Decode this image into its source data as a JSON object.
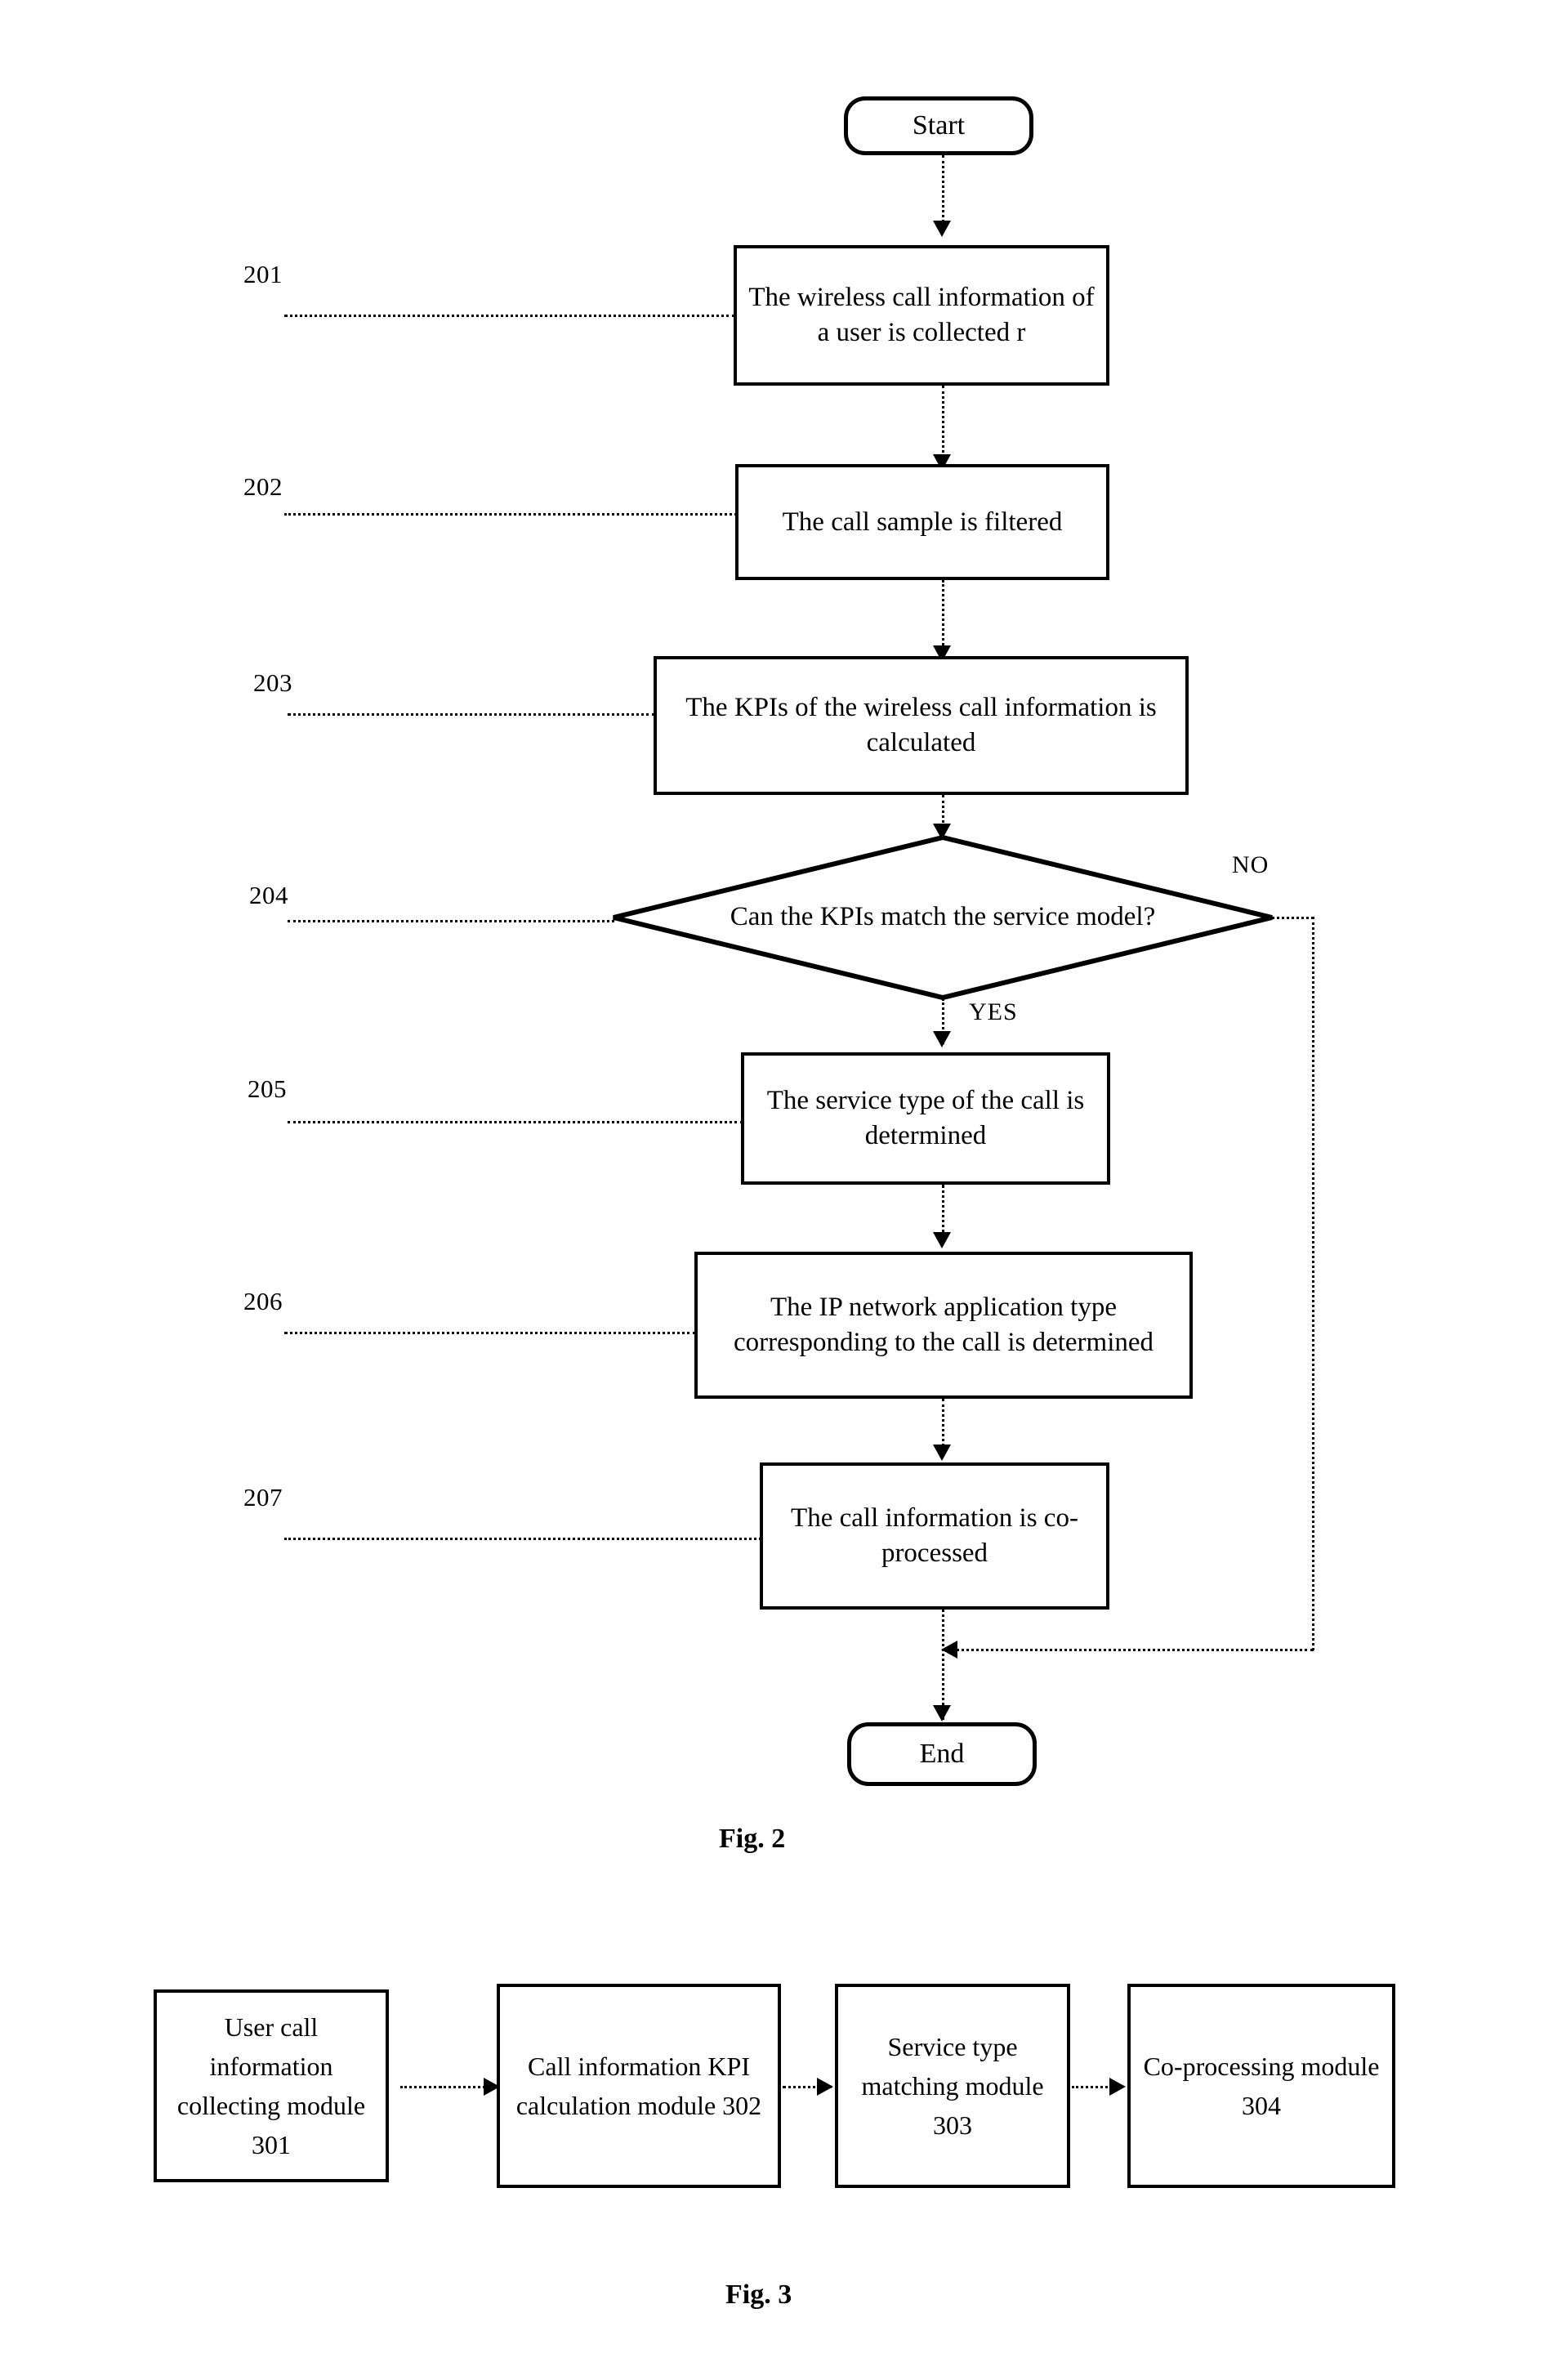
{
  "figure2": {
    "caption": "Fig. 2",
    "start": {
      "label": "Start"
    },
    "end": {
      "label": "End"
    },
    "branches": {
      "yes": "YES",
      "no": "NO"
    },
    "steps": [
      {
        "num": "201",
        "text": "The wireless call information of a user is collected r"
      },
      {
        "num": "202",
        "text": "The call sample is filtered"
      },
      {
        "num": "203",
        "text": "The KPIs of the wireless call information is calculated"
      },
      {
        "num": "204",
        "text": "Can the KPIs match the service model?"
      },
      {
        "num": "205",
        "text": "The service type of the call is determined"
      },
      {
        "num": "206",
        "text": "The IP network application type corresponding to the call is determined"
      },
      {
        "num": "207",
        "text": "The call information is co-processed"
      }
    ]
  },
  "figure3": {
    "caption": "Fig. 3",
    "modules": [
      {
        "text": "User call information collecting module 301"
      },
      {
        "text": "Call information KPI calculation module 302"
      },
      {
        "text": "Service type matching module 303"
      },
      {
        "text": "Co-processing module 304"
      }
    ]
  }
}
